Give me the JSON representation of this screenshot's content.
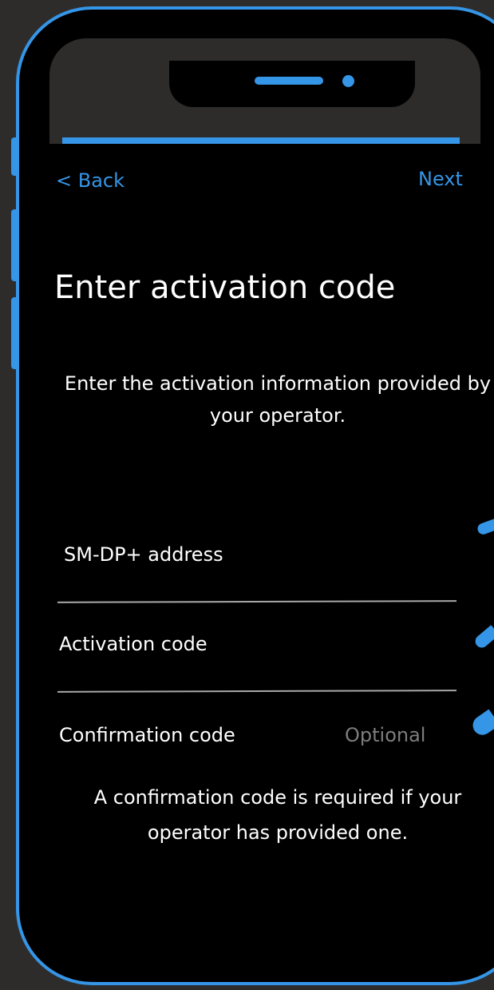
{
  "nav": {
    "back_label": "< Back",
    "next_label": "Next"
  },
  "screen": {
    "title": "Enter activation code",
    "subtitle": "Enter the activation information provided by your operator."
  },
  "fields": {
    "sm_dp_label": "SM-DP+ address",
    "activation_label": "Activation code",
    "confirmation_label": "Confirmation code",
    "confirmation_hint": "Optional"
  },
  "helper_text": "A confirmation code is required if your operator has provided one.",
  "colors": {
    "accent": "#3595e6",
    "background": "#000000",
    "frame_bg": "#2e2c2b",
    "divider": "#a8a8a8",
    "hint": "#7d7d7d"
  }
}
